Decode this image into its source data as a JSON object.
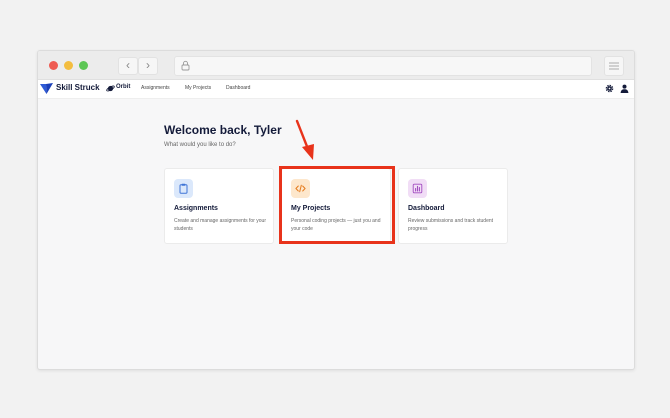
{
  "browser": {
    "back_glyph": "‹",
    "forward_glyph": "›",
    "icons": [
      "lock-icon",
      "menu-icon"
    ]
  },
  "app": {
    "brand": "Skill Struck",
    "product": "Orbit",
    "nav": [
      "Assignments",
      "My Projects",
      "Dashboard"
    ],
    "icons": [
      "settings-gear-icon",
      "user-icon"
    ]
  },
  "main": {
    "welcome": "Welcome back, Tyler",
    "subtitle": "What would you like to do?",
    "cards": [
      {
        "title": "Assignments",
        "description": "Create and manage assignments for your students",
        "icon": "clipboard-icon",
        "icon_bg": "#dbe8fb",
        "icon_color": "#3f74d6"
      },
      {
        "title": "My Projects",
        "description": "Personal coding projects — just you and your code",
        "icon": "code-icon",
        "icon_bg": "#fde7cc",
        "icon_color": "#e57a1b"
      },
      {
        "title": "Dashboard",
        "description": "Review submissions and track student progress",
        "icon": "bar-chart-icon",
        "icon_bg": "#f1ddf6",
        "icon_color": "#a24cc0"
      }
    ]
  },
  "annotation": {
    "highlight_color": "#e8331b"
  }
}
